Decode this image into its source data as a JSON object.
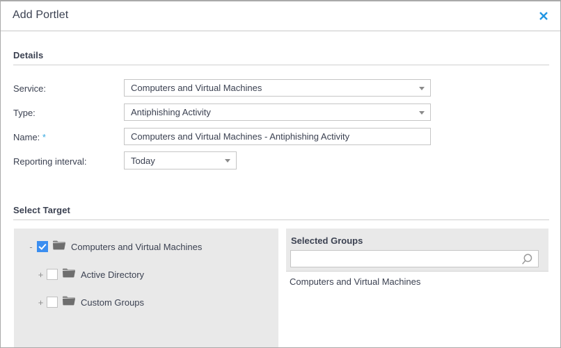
{
  "dialog": {
    "title": "Add Portlet",
    "close_icon": "close-icon"
  },
  "details": {
    "heading": "Details",
    "fields": [
      {
        "label": "Service:",
        "value": "Computers and Virtual Machines",
        "type": "select"
      },
      {
        "label": "Type:",
        "value": "Antiphishing Activity",
        "type": "select"
      },
      {
        "label": "Name:",
        "required_marker": "*",
        "value": "Computers and Virtual Machines - Antiphishing Activity",
        "type": "text"
      },
      {
        "label": "Reporting interval:",
        "value": "Today",
        "type": "select"
      }
    ]
  },
  "select_target": {
    "heading": "Select Target",
    "tree": [
      {
        "expander": "-",
        "checked": true,
        "label": "Computers and Virtual Machines",
        "icon": "folder-icon"
      },
      {
        "expander": "+",
        "checked": false,
        "label": "Active Directory",
        "icon": "folder-icon"
      },
      {
        "expander": "+",
        "checked": false,
        "label": "Custom Groups",
        "icon": "folder-icon"
      }
    ],
    "selected_groups": {
      "title": "Selected Groups",
      "search_value": "",
      "search_placeholder": "",
      "search_icon": "search-icon",
      "items": [
        "Computers and Virtual Machines"
      ]
    }
  },
  "colors": {
    "accent": "#37a8e0",
    "checkbox_checked": "#3b8ef0",
    "text": "#3b4151",
    "panel_bg": "#e9e9e9",
    "border": "#c5c5c5"
  }
}
